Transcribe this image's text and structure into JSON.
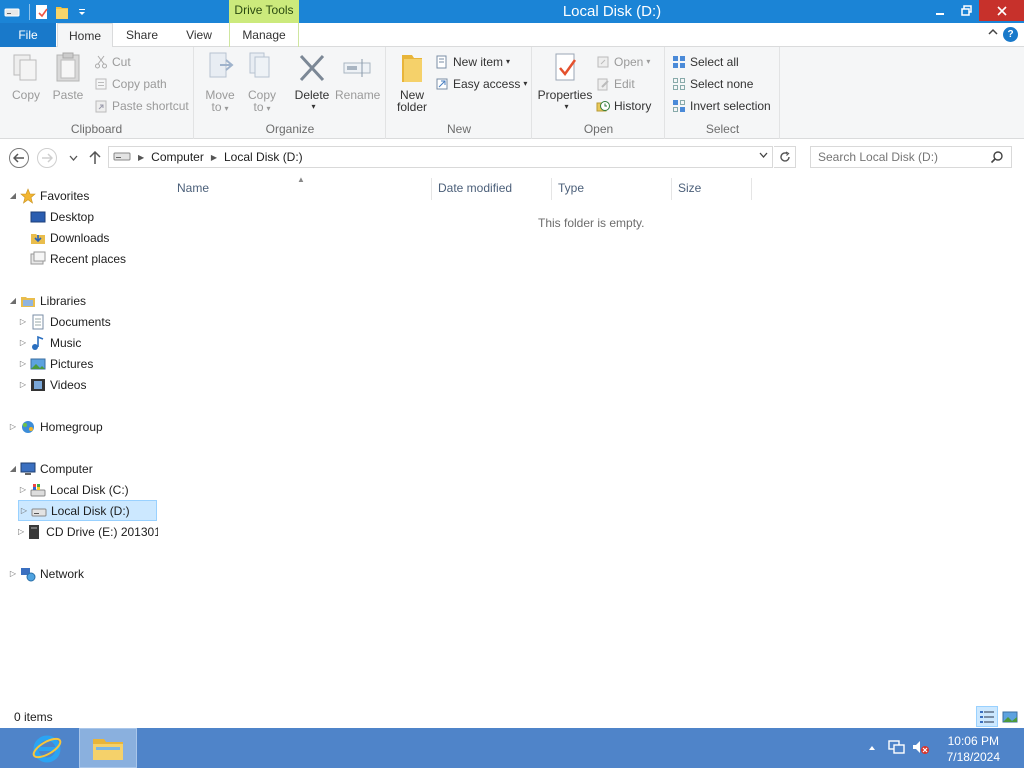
{
  "window": {
    "title": "Local Disk (D:)",
    "context_tab": "Drive Tools"
  },
  "tabs": {
    "file": "File",
    "home": "Home",
    "share": "Share",
    "view": "View",
    "manage": "Manage"
  },
  "ribbon": {
    "clipboard": {
      "label": "Clipboard",
      "copy": "Copy",
      "paste": "Paste",
      "cut": "Cut",
      "copy_path": "Copy path",
      "paste_shortcut": "Paste shortcut"
    },
    "organize": {
      "label": "Organize",
      "move_to_1": "Move",
      "move_to_2": "to",
      "copy_to_1": "Copy",
      "copy_to_2": "to",
      "delete": "Delete",
      "rename": "Rename"
    },
    "new": {
      "label": "New",
      "new_folder_1": "New",
      "new_folder_2": "folder",
      "new_item": "New item",
      "easy_access": "Easy access"
    },
    "open": {
      "label": "Open",
      "properties": "Properties",
      "open": "Open",
      "edit": "Edit",
      "history": "History"
    },
    "select": {
      "label": "Select",
      "select_all": "Select all",
      "select_none": "Select none",
      "invert_selection": "Invert selection"
    }
  },
  "address": {
    "crumbs": [
      "Computer",
      "Local Disk (D:)"
    ],
    "search_placeholder": "Search Local Disk (D:)"
  },
  "nav": {
    "favorites": "Favorites",
    "desktop": "Desktop",
    "downloads": "Downloads",
    "recent_places": "Recent places",
    "libraries": "Libraries",
    "documents": "Documents",
    "music": "Music",
    "pictures": "Pictures",
    "videos": "Videos",
    "homegroup": "Homegroup",
    "computer": "Computer",
    "local_c": "Local Disk (C:)",
    "local_d": "Local Disk (D:)",
    "cd_drive": "CD Drive (E:) 201301",
    "network": "Network"
  },
  "columns": {
    "name": "Name",
    "date_modified": "Date modified",
    "type": "Type",
    "size": "Size"
  },
  "empty_message": "This folder is empty.",
  "status": {
    "items": "0 items"
  },
  "taskbar": {
    "time": "10:06 PM",
    "date": "7/18/2024"
  },
  "colors": {
    "titlebar": "#1b84d6",
    "file_tab": "#1979ca",
    "context_tab": "#ccea7c",
    "taskbar": "#4f84c9",
    "selection": "#cce8ff"
  }
}
